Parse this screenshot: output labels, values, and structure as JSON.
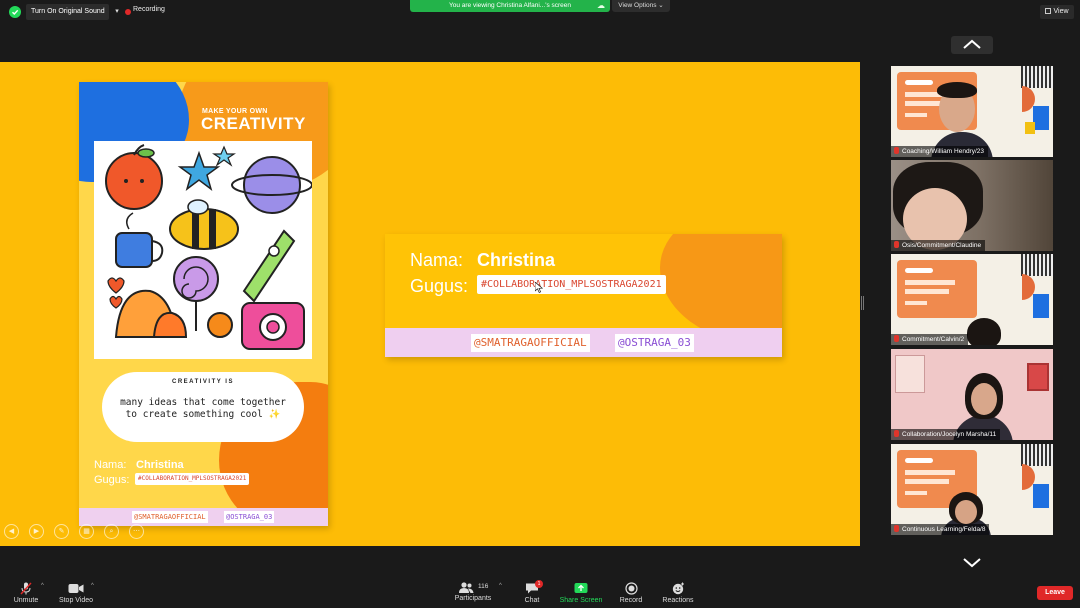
{
  "topbar": {
    "sound_label": "Turn On Original Sound",
    "recording_label": "Recording",
    "viewing_banner": "You are viewing Christina Alfani...'s screen",
    "view_options": "View Options ⌄",
    "view_label": "View"
  },
  "poster": {
    "subtitle": "MAKE YOUR OWN",
    "title": "CREATIVITY",
    "quote_heading": "CREATIVITY IS",
    "quote_line1": "many ideas that come together",
    "quote_line2": "to create something cool ✨",
    "name_label": "Nama:",
    "name_value": "Christina",
    "gugus_label": "Gugus:",
    "gugus_value": "#COLLABORATION_MPLSOSTRAGA2021",
    "handle1": "@SMATRAGAOFFICIAL",
    "handle2": "@OSTRAGA_03"
  },
  "name_card": {
    "name_label": "Nama:",
    "name_value": "Christina",
    "gugus_label": "Gugus:",
    "gugus_value": "#COLLABORATION_MPLSOSTRAGA2021",
    "handle1": "@SMATRAGAOFFICIAL",
    "handle2": "@OSTRAGA_03"
  },
  "participants": [
    {
      "name": "Coaching/William Hendry/23",
      "muted": true
    },
    {
      "name": "Osis/Commitment/Claudine",
      "muted": true
    },
    {
      "name": "Commitment/Calvin/2",
      "muted": true
    },
    {
      "name": "Collaboration/Jocelyn Marsha/11",
      "muted": true
    },
    {
      "name": "Continuous Learning/Felda/8",
      "muted": true
    }
  ],
  "toolbar": {
    "unmute": "Unmute",
    "stop_video": "Stop Video",
    "participants_count": "116",
    "participants": "Participants",
    "chat": "Chat",
    "chat_badge": "1",
    "share_screen": "Share Screen",
    "record": "Record",
    "reactions": "Reactions",
    "leave": "Leave"
  },
  "colors": {
    "share_bg": "#fdbc06",
    "share_screen_green": "#23d959",
    "leave_red": "#e02828",
    "banner_green": "#23b34a"
  }
}
